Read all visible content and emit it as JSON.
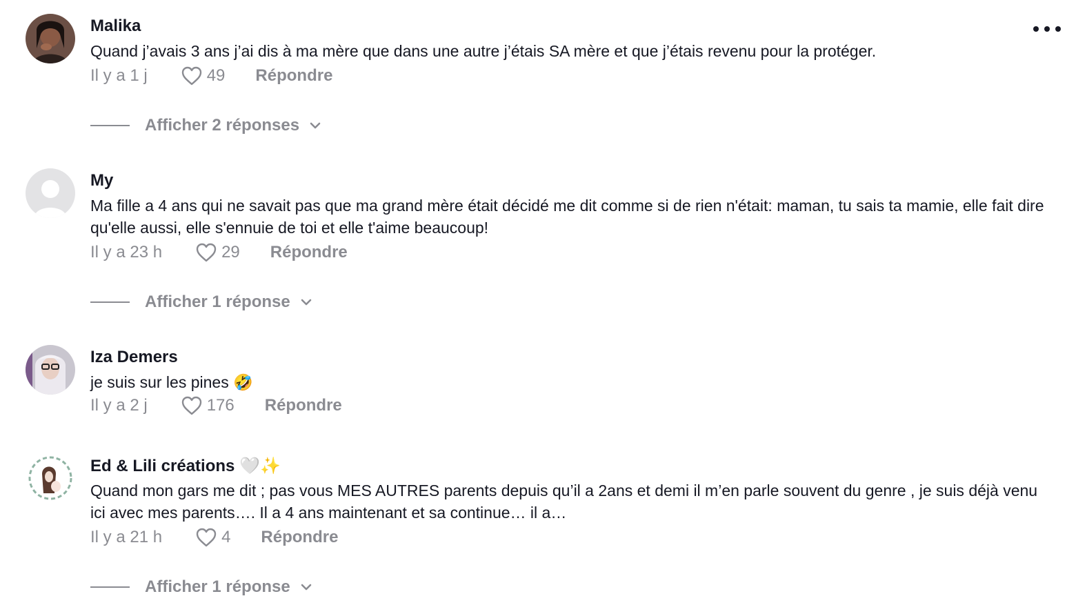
{
  "comments": [
    {
      "username": "Malika",
      "text": "Quand j’avais 3 ans j’ai dis à ma mère que dans une autre j’étais SA mère et que j’étais revenu pour la protéger.",
      "time": "Il y a 1 j",
      "likes": "49",
      "reply_label": "Répondre",
      "show_replies": "Afficher 2 réponses"
    },
    {
      "username": "My",
      "text": "Ma fille a 4 ans qui ne savait pas que ma grand mère était décidé me dit comme si de rien n'était: maman, tu sais ta mamie, elle fait dire qu'elle aussi, elle s'ennuie de toi et elle t'aime beaucoup!",
      "time": "Il y a 23 h",
      "likes": "29",
      "reply_label": "Répondre",
      "show_replies": "Afficher 1 réponse"
    },
    {
      "username": "Iza Demers",
      "text": "je suis sur les pines",
      "emoji": "🤣",
      "time": "Il y a 2 j",
      "likes": "176",
      "reply_label": "Répondre"
    },
    {
      "username": "Ed & Lili créations",
      "username_emoji": "🤍✨",
      "text": "Quand mon gars me dit ; pas vous MES AUTRES parents depuis qu’il a 2ans et demi il m’en parle souvent du genre , je suis déjà venu ici avec mes parents…. Il a 4 ans maintenant et sa continue… il a…",
      "time": "Il y a 21 h",
      "likes": "4",
      "reply_label": "Répondre",
      "show_replies": "Afficher 1 réponse"
    }
  ],
  "icons": {
    "more": "more-options-icon",
    "like": "heart-outline-icon",
    "chevron": "chevron-down-icon"
  }
}
